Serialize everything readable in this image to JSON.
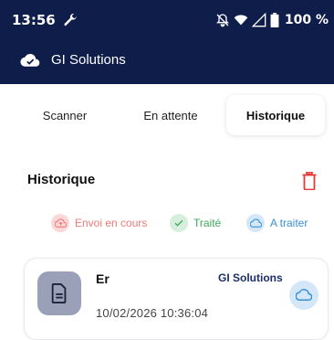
{
  "status_bar": {
    "time": "13:56",
    "battery": "100 %"
  },
  "app": {
    "title": "GI Solutions"
  },
  "tabs": [
    {
      "label": "Scanner"
    },
    {
      "label": "En attente"
    },
    {
      "label": "Historique",
      "active": true
    }
  ],
  "section": {
    "title": "Historique"
  },
  "legend": [
    {
      "label": "Envoi en cours",
      "color": "#ef7a7a"
    },
    {
      "label": "Traité",
      "color": "#3fa95a"
    },
    {
      "label": "A traiter",
      "color": "#3c8fd4"
    }
  ],
  "history": [
    {
      "title": "Er",
      "organization": "GI Solutions",
      "date": "10/02/2026 10:36:04",
      "status": "A traiter"
    }
  ],
  "colors": {
    "header_bg": "#0f1d4b",
    "danger": "#e53935",
    "accent": "#1d2f6b"
  }
}
